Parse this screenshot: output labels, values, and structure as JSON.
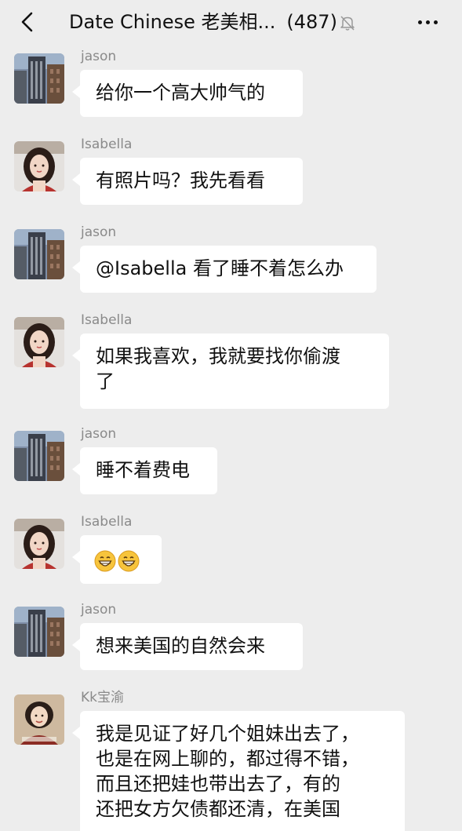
{
  "header": {
    "title": "Date Chinese 老美相...",
    "member_count": "(487)",
    "back_icon": "back-arrow-icon",
    "mute_icon": "bell-muted-icon",
    "more_icon": "more-dots-icon"
  },
  "messages": [
    {
      "sender": "jason",
      "text": "给你一个高大帅气的"
    },
    {
      "sender": "Isabella",
      "text": "有照片吗？我先看看"
    },
    {
      "sender": "jason",
      "text": "@Isabella 看了睡不着怎么办"
    },
    {
      "sender": "Isabella",
      "text": "如果我喜欢，我就要找你偷渡\n了"
    },
    {
      "sender": "jason",
      "text": "睡不着费电"
    },
    {
      "sender": "Isabella",
      "text": "😁😁",
      "emoji": "grinning-face-icon"
    },
    {
      "sender": "jason",
      "text": "想来美国的自然会来"
    },
    {
      "sender": "Kk宝渝",
      "text": "我是见证了好几个姐妹出去了，\n也是在网上聊的，都过得不错，\n而且还把娃也带出去了，有的\n还把女方欠债都还清，在美国"
    }
  ]
}
